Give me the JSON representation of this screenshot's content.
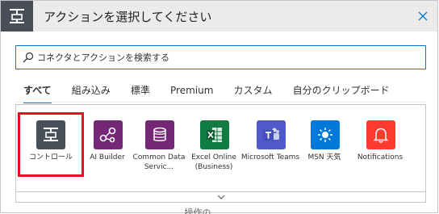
{
  "header": {
    "title": "アクションを選択してください",
    "icon": "control-icon",
    "close_icon": "close-icon"
  },
  "search": {
    "placeholder": "コネクタとアクションを検索する",
    "value": ""
  },
  "tabs": [
    {
      "label": "すべて",
      "active": true
    },
    {
      "label": "組み込み",
      "active": false
    },
    {
      "label": "標準",
      "active": false
    },
    {
      "label": "Premium",
      "active": false
    },
    {
      "label": "カスタム",
      "active": false
    },
    {
      "label": "自分のクリップボード",
      "active": false
    }
  ],
  "connectors": [
    {
      "label": "コントロール",
      "color": "#484f58",
      "icon": "control-icon",
      "selected": true
    },
    {
      "label": "AI Builder",
      "color": "#742774",
      "icon": "ai-builder-icon",
      "selected": false
    },
    {
      "label": "Common Data Servic...",
      "color": "#742774",
      "icon": "database-icon",
      "selected": false
    },
    {
      "label": "Excel Online (Business)",
      "color": "#107c41",
      "icon": "excel-icon",
      "selected": false
    },
    {
      "label": "Microsoft Teams",
      "color": "#5059c9",
      "icon": "teams-icon",
      "selected": false
    },
    {
      "label": "MSN 天気",
      "color": "#0078d7",
      "icon": "sun-icon",
      "selected": false
    },
    {
      "label": "Notifications",
      "color": "#ff3b30",
      "icon": "bell-icon",
      "selected": false
    }
  ],
  "footer": {
    "expand_icon": "chevron-down-icon",
    "cutoff_text": "… 操作の…"
  },
  "colors": {
    "accent": "#0078d4",
    "selection": "#e81123",
    "header_bg": "#edebe9"
  }
}
